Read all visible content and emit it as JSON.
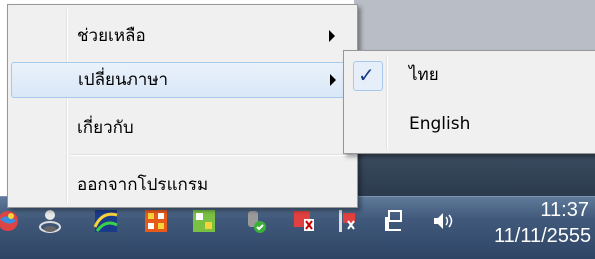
{
  "context_menu": {
    "items": [
      {
        "label": "ช่วยเหลือ",
        "has_submenu": true
      },
      {
        "label": "เปลี่ยนภาษา",
        "has_submenu": true,
        "highlighted": true
      },
      {
        "label": "เกี่ยวกับ",
        "has_submenu": false
      },
      {
        "label": "ออกจากโปรแกรม",
        "has_submenu": false
      }
    ]
  },
  "language_submenu": {
    "items": [
      {
        "label": "ไทย",
        "checked": true,
        "check_glyph": "✓"
      },
      {
        "label": "English",
        "checked": false
      }
    ]
  },
  "taskbar": {
    "clock_time": "11:37",
    "clock_date": "11/11/2555",
    "tray_icons": [
      "globe-icon",
      "user-network-icon",
      "colorful-app-icon",
      "grid-app-icon",
      "grid-app-2-icon",
      "antivirus-icon",
      "flag-icon",
      "action-center-icon",
      "network-icon",
      "volume-icon"
    ]
  },
  "colors": {
    "highlight_border": "#a8c8ec",
    "menu_bg": "#f0f0f0",
    "taskbar": "#41597a"
  }
}
